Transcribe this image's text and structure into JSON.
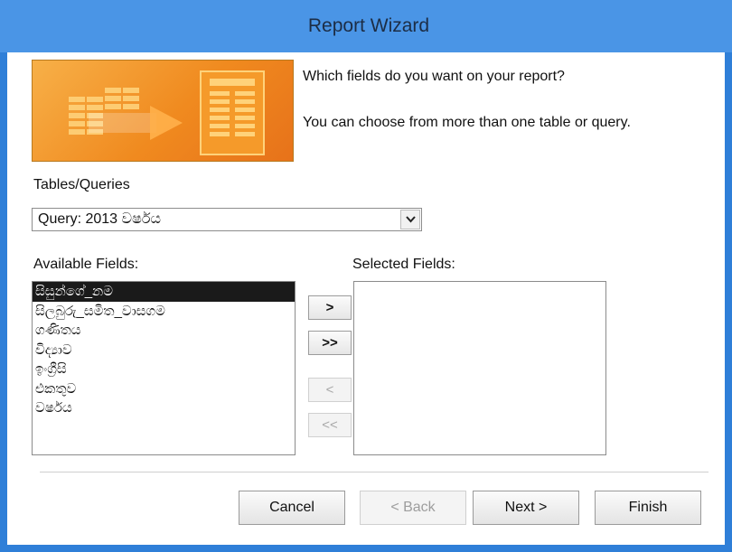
{
  "window": {
    "title": "Report Wizard"
  },
  "header": {
    "question": "Which fields do you want on your report?",
    "hint": "You can choose from more than one table or query."
  },
  "colors": {
    "title_bar": "#4a95e6",
    "window_border": "#2f7fd8",
    "banner_orange": "#f08a1f",
    "selection": "#1a1a1a"
  },
  "tables_queries": {
    "label": "Tables/Queries",
    "value": "Query: 2013 වර්ෂය"
  },
  "available": {
    "label": "Available Fields:",
    "items": [
      {
        "label": "සිසුන්ගේ_නම",
        "selected": true
      },
      {
        "label": "සිලබුරු_සමිත_වාසගම",
        "selected": false
      },
      {
        "label": "ගණිතය",
        "selected": false
      },
      {
        "label": "විද්‍යාව",
        "selected": false
      },
      {
        "label": "ඉංග්‍රීසි",
        "selected": false
      },
      {
        "label": "එකතුව",
        "selected": false
      },
      {
        "label": "වර්ෂය",
        "selected": false
      }
    ]
  },
  "selected": {
    "label": "Selected Fields:",
    "items": []
  },
  "move_buttons": {
    "add_one": ">",
    "add_all": ">>",
    "remove_one": "<",
    "remove_all": "<<"
  },
  "buttons": {
    "cancel": "Cancel",
    "back": "< Back",
    "next": "Next >",
    "finish": "Finish"
  }
}
